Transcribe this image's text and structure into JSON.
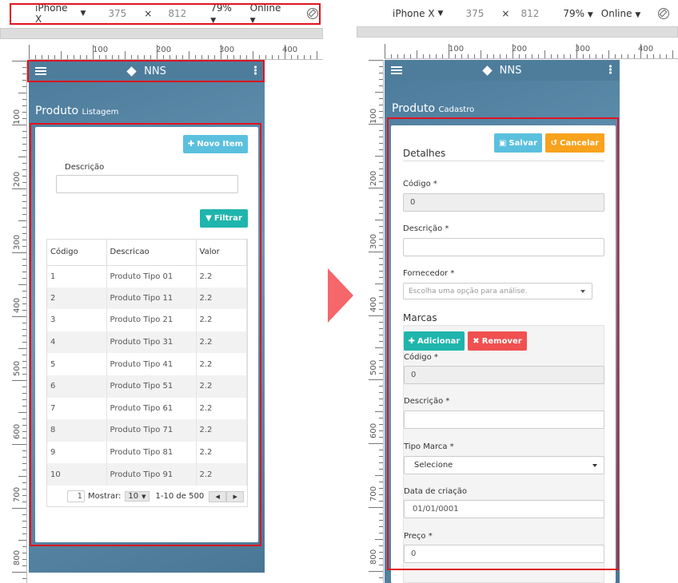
{
  "left": {
    "device_bar": {
      "device": "iPhone X",
      "width": "375",
      "times": "×",
      "height": "812",
      "zoom": "79%",
      "network": "Online"
    },
    "ruler_h_labels": [
      "100",
      "200",
      "300",
      "400"
    ],
    "ruler_v_labels": [
      "100",
      "200",
      "300",
      "400",
      "500",
      "600",
      "700",
      "800"
    ],
    "app": {
      "brand": "NNS"
    },
    "page": {
      "title": "Produto",
      "subtitle": "Listagem"
    },
    "new_item_label": "Novo Item",
    "filter_label": "Filtrar",
    "descricao_label": "Descrição",
    "table": {
      "headers": [
        "Código",
        "Descricao",
        "Valor"
      ],
      "rows": [
        [
          "1",
          "Produto Tipo 01",
          "2.2"
        ],
        [
          "2",
          "Produto Tipo 11",
          "2.2"
        ],
        [
          "3",
          "Produto Tipo 21",
          "2.2"
        ],
        [
          "4",
          "Produto Tipo 31",
          "2.2"
        ],
        [
          "5",
          "Produto Tipo 41",
          "2.2"
        ],
        [
          "6",
          "Produto Tipo 51",
          "2.2"
        ],
        [
          "7",
          "Produto Tipo 61",
          "2.2"
        ],
        [
          "8",
          "Produto Tipo 71",
          "2.2"
        ],
        [
          "9",
          "Produto Tipo 81",
          "2.2"
        ],
        [
          "10",
          "Produto Tipo 91",
          "2.2"
        ]
      ]
    },
    "pager": {
      "page": "1",
      "show_label": "Mostrar:",
      "page_size": "10",
      "range": "1-10 de 500"
    }
  },
  "right": {
    "device_bar": {
      "device": "iPhone X",
      "width": "375",
      "times": "×",
      "height": "812",
      "zoom": "79%",
      "network": "Online"
    },
    "app": {
      "brand": "NNS"
    },
    "page": {
      "title": "Produto",
      "subtitle": "Cadastro"
    },
    "save_label": "Salvar",
    "cancel_label": "Cancelar",
    "section_details": "Detalhes",
    "codigo_label": "Código *",
    "codigo_value": "0",
    "descricao_label": "Descrição *",
    "fornecedor_label": "Fornecedor *",
    "fornecedor_placeholder": "Escolha uma opção para análise.",
    "section_marcas": "Marcas",
    "add_label": "Adicionar",
    "remove_label": "Remover",
    "marca_codigo_label": "Código *",
    "marca_codigo_value": "0",
    "marca_descricao_label": "Descrição *",
    "tipo_marca_label": "Tipo Marca *",
    "tipo_marca_value": "Selecione",
    "data_label": "Data de criação",
    "data_value": "01/01/0001",
    "preco_label": "Preço *",
    "preco_value": "0"
  },
  "colors": {
    "highlight": "#e0141e",
    "arrow": "#f5676a",
    "info": "#5bc0de",
    "teal": "#1fb5ac",
    "orange": "#f8a21d",
    "danger": "#f05050"
  }
}
